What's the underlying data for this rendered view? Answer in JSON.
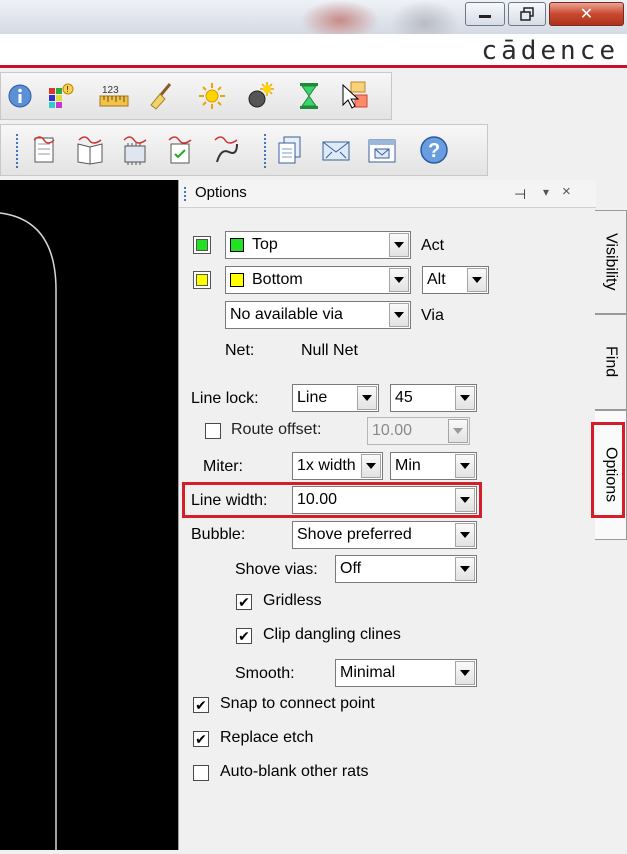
{
  "window": {
    "brand": "cādence",
    "close_glyph": "✕"
  },
  "toolbar1": {
    "icons": [
      "info-icon",
      "color-grid-icon",
      "ruler-icon",
      "broom-icon",
      "sun-icon",
      "sun-bomb-icon",
      "hourglass-icon",
      "cursor-pointer-icon"
    ]
  },
  "toolbar2": {
    "icons": [
      "report-icon",
      "book-icon",
      "package-icon",
      "checklist-icon",
      "wire-probe-icon",
      "copy-docs-icon",
      "envelope-x-icon",
      "envelope-box-icon",
      "help-icon"
    ]
  },
  "panel": {
    "title": "Options",
    "pin": "⊣",
    "menu": "▾",
    "close": "×"
  },
  "side_tabs": [
    "Visibility",
    "Find",
    "Options"
  ],
  "layers": {
    "top": {
      "label": "Top",
      "color": "#22e022"
    },
    "bottom": {
      "label": "Bottom",
      "color": "#ffff00"
    },
    "act_label": "Act",
    "alt_value": "Alt",
    "via_value": "No available via",
    "via_label": "Via"
  },
  "net": {
    "label": "Net:",
    "value": "Null Net"
  },
  "line_lock": {
    "label": "Line lock:",
    "mode": "Line",
    "angle": "45"
  },
  "route_offset": {
    "label": "Route offset:",
    "value": "10.00",
    "checked": false
  },
  "miter": {
    "label": "Miter:",
    "size": "1x width",
    "mode": "Min"
  },
  "line_width": {
    "label": "Line width:",
    "value": "10.00"
  },
  "bubble": {
    "label": "Bubble:",
    "value": "Shove preferred"
  },
  "shove_vias": {
    "label": "Shove vias:",
    "value": "Off"
  },
  "gridless": {
    "label": "Gridless",
    "checked": true
  },
  "clip_dangling": {
    "label": "Clip dangling clines",
    "checked": true
  },
  "smooth": {
    "label": "Smooth:",
    "value": "Minimal"
  },
  "snap": {
    "label": "Snap to connect point",
    "checked": true
  },
  "replace_etch": {
    "label": "Replace etch",
    "checked": true
  },
  "auto_blank": {
    "label": "Auto-blank other rats",
    "checked": false
  },
  "check_glyph": "✔",
  "colors": {
    "highlight": "#d41f2a",
    "accent": "#c8102e"
  }
}
